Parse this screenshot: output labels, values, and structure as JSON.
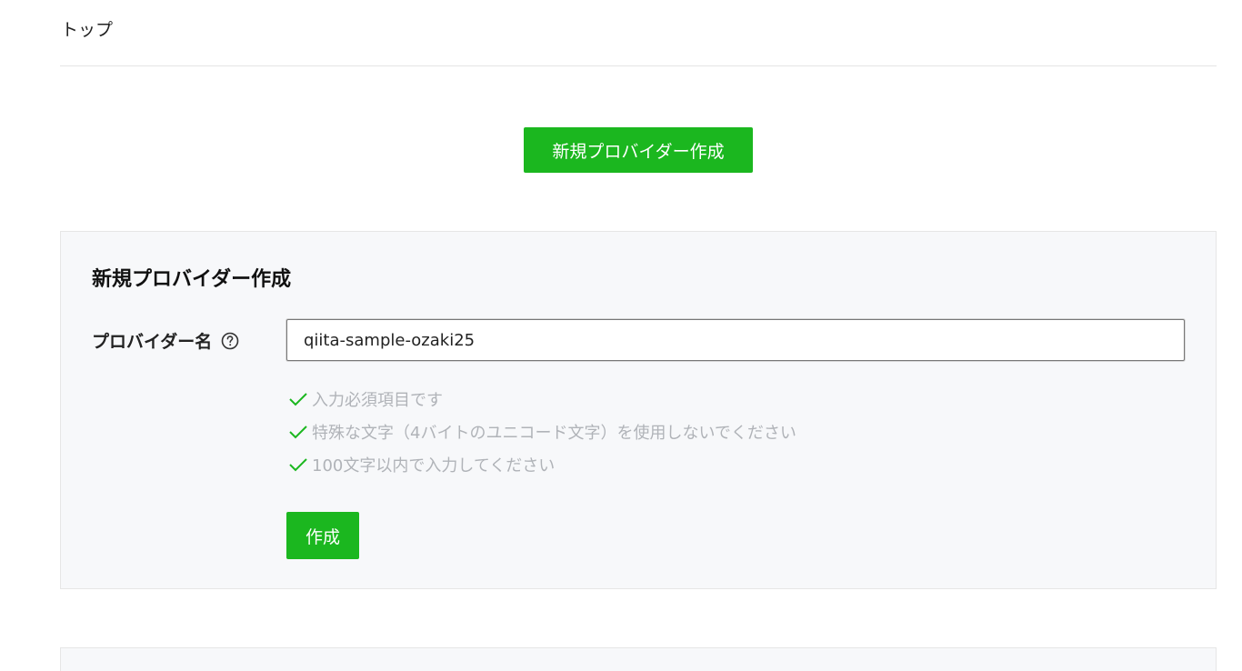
{
  "header": {
    "breadcrumb": "トップ"
  },
  "actions": {
    "new_provider_label": "新規プロバイダー作成"
  },
  "form": {
    "title": "新規プロバイダー作成",
    "provider_name_label": "プロバイダー名",
    "provider_name_value": "qiita-sample-ozaki25",
    "help_icon": "question-circle-icon",
    "rules": [
      {
        "text": "入力必須項目です",
        "icon": "check-icon"
      },
      {
        "text": "特殊な文字（4バイトのユニコード文字）を使用しないでください",
        "icon": "check-icon"
      },
      {
        "text": "100文字以内で入力してください",
        "icon": "check-icon"
      }
    ],
    "submit_label": "作成"
  },
  "colors": {
    "accent_green": "#1bb71f",
    "panel_bg": "#f7f8fa",
    "rule_text": "#b0b3b8"
  }
}
